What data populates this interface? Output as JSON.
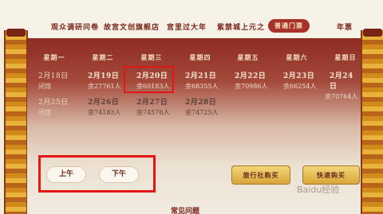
{
  "nav": {
    "items": [
      "观众调研问卷",
      "故宫文创旗舰店",
      "宫里过大年",
      "紫禁城上元之",
      "普通门票",
      "年票"
    ],
    "active": "普通门票"
  },
  "calendar": {
    "weekdays": [
      "星期一",
      "星期二",
      "星期三",
      "星期四",
      "星期五",
      "星期六",
      "星期日"
    ],
    "row1": [
      {
        "date": "2月18日",
        "status": "闭馆"
      },
      {
        "date": "2月19日",
        "status": "余27761人"
      },
      {
        "date": "2月20日",
        "status": "余60183人"
      },
      {
        "date": "2月21日",
        "status": "余68355人"
      },
      {
        "date": "2月22日",
        "status": "余70986人"
      },
      {
        "date": "2月23日",
        "status": "余66254人"
      },
      {
        "date": "2月24日",
        "status": "余70764人"
      }
    ],
    "row2": [
      {
        "date": "2月25日",
        "status": "闭馆"
      },
      {
        "date": "2月26日",
        "status": "余74183人"
      },
      {
        "date": "2月27日",
        "status": "余74576人"
      },
      {
        "date": "2月28日",
        "status": "余74725人"
      }
    ]
  },
  "session": {
    "am": "上午",
    "pm": "下午"
  },
  "buttons": {
    "agency": "旅行社购买",
    "individual": "快速购买"
  },
  "bottom_title": "常见问题",
  "watermark": "Baidu经验"
}
